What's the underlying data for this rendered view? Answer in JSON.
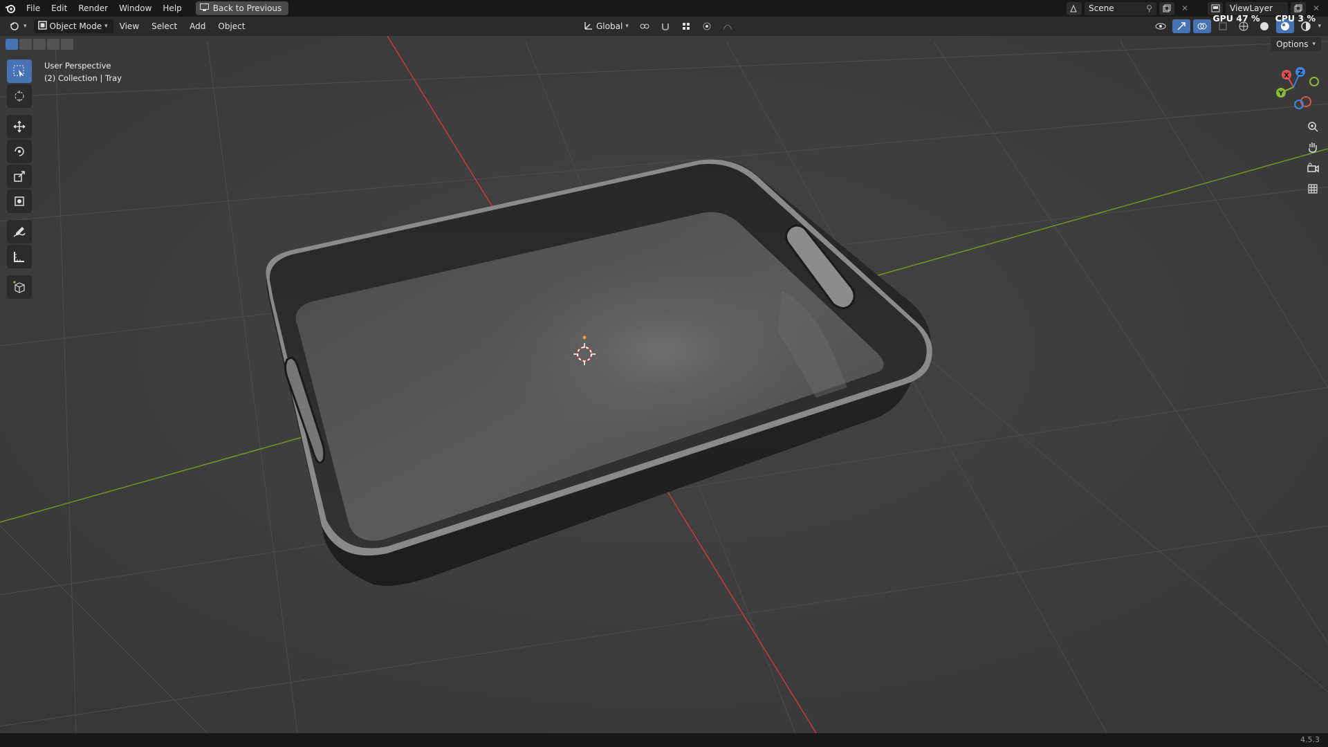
{
  "menu": {
    "items": [
      "File",
      "Edit",
      "Render",
      "Window",
      "Help"
    ],
    "back_label": "Back to Previous"
  },
  "top_right": {
    "scene": "Scene",
    "view_layer": "ViewLayer",
    "gpu_label": "GPU",
    "gpu_value": "47 %",
    "cpu_label": "CPU",
    "cpu_value": "3 %"
  },
  "header": {
    "mode": "Object Mode",
    "menus": [
      "View",
      "Select",
      "Add",
      "Object"
    ],
    "orientation": "Global",
    "options": "Options"
  },
  "viewport": {
    "perspective": "User Perspective",
    "collection": "(2) Collection | Tray",
    "object_name": "Tray"
  },
  "toolbar": {
    "tools": [
      "select-box",
      "cursor",
      "move",
      "rotate",
      "scale",
      "transform",
      "annotate",
      "measure",
      "add-cube"
    ]
  },
  "gizmo": {
    "axes": [
      "X",
      "Y",
      "Z"
    ],
    "colors": {
      "x": "#e2504d",
      "y": "#8bbb34",
      "z": "#3a86e2"
    }
  },
  "status": {
    "version": "4.5.3"
  },
  "colors": {
    "accent": "#4772b3",
    "background": "#3d3d3d",
    "x_axis": "#c83a3a",
    "y_axis": "#6e9a25"
  }
}
